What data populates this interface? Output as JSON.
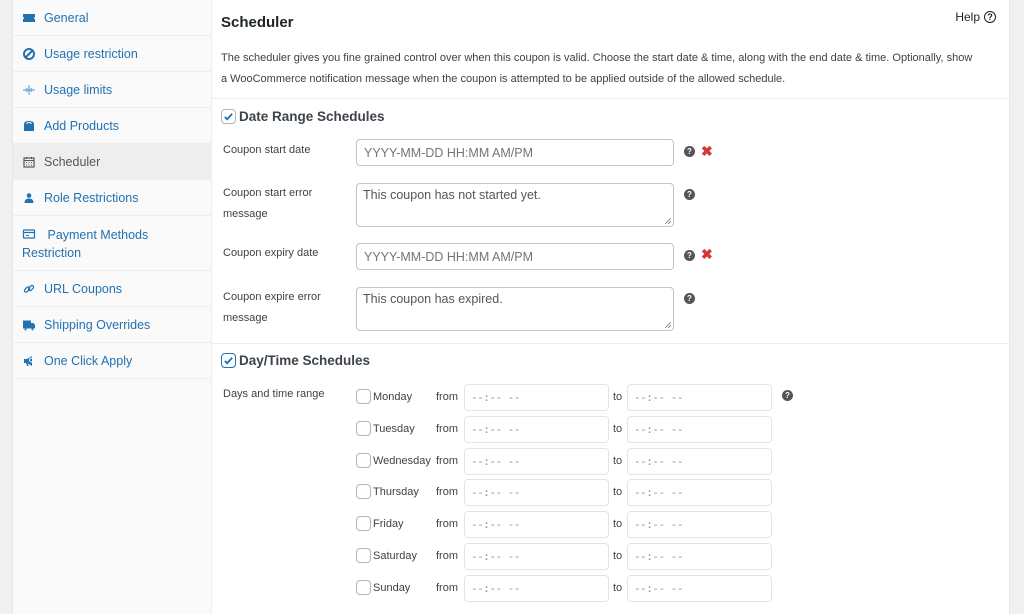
{
  "sidebar": {
    "items": [
      {
        "label": "General",
        "icon": "ticket-icon",
        "active": false
      },
      {
        "label": "Usage restriction",
        "icon": "block-icon",
        "active": false
      },
      {
        "label": "Usage limits",
        "icon": "limits-icon",
        "active": false
      },
      {
        "label": "Add Products",
        "icon": "bag-icon",
        "active": false
      },
      {
        "label": "Scheduler",
        "icon": "calendar-icon",
        "active": true
      },
      {
        "label": "Role Restrictions",
        "icon": "user-icon",
        "active": false
      },
      {
        "label": "Payment Methods Restriction",
        "label_line1": "Payment Methods",
        "label_line2": "Restriction",
        "icon": "card-icon",
        "active": false
      },
      {
        "label": "URL Coupons",
        "icon": "link-icon",
        "active": false
      },
      {
        "label": "Shipping Overrides",
        "icon": "truck-icon",
        "active": false
      },
      {
        "label": "One Click Apply",
        "icon": "megaphone-icon",
        "active": false
      }
    ]
  },
  "panel": {
    "title": "Scheduler",
    "help_label": "Help",
    "help_icon": "?",
    "intro_line1": "The scheduler gives you fine grained control over when this coupon is valid. Choose the start date & time, along with the end date & time. Optionally, show",
    "intro_line2": "a WooCommerce notification message when the coupon is attempted to be applied outside of the allowed schedule."
  },
  "date_range": {
    "heading": "Date Range Schedules",
    "checked": true,
    "start_date": {
      "label": "Coupon start date",
      "value": "",
      "placeholder": "YYYY-MM-DD HH:MM AM/PM"
    },
    "start_error": {
      "label_line1": "Coupon start error",
      "label_line2": "message",
      "value": "This coupon has not started yet."
    },
    "expiry_date": {
      "label": "Coupon expiry date",
      "value": "",
      "placeholder": "YYYY-MM-DD HH:MM AM/PM"
    },
    "expire_error": {
      "label_line1": "Coupon expire error",
      "label_line2": "message",
      "value": "This coupon has expired."
    },
    "tip_icon": "?",
    "remove_icon": "✖"
  },
  "day_time": {
    "heading": "Day/Time Schedules",
    "checked": true,
    "label": "Days and time range",
    "from_label": "from",
    "to_label": "to",
    "time_placeholder": "--:-- --",
    "days": [
      {
        "name": "Monday",
        "checked": false,
        "from": "--:-- --",
        "to": "--:-- --"
      },
      {
        "name": "Tuesday",
        "checked": false,
        "from": "--:-- --",
        "to": "--:-- --"
      },
      {
        "name": "Wednesday",
        "checked": false,
        "from": "--:-- --",
        "to": "--:-- --"
      },
      {
        "name": "Thursday",
        "checked": false,
        "from": "--:-- --",
        "to": "--:-- --"
      },
      {
        "name": "Friday",
        "checked": false,
        "from": "--:-- --",
        "to": "--:-- --"
      },
      {
        "name": "Saturday",
        "checked": false,
        "from": "--:-- --",
        "to": "--:-- --"
      },
      {
        "name": "Sunday",
        "checked": false,
        "from": "--:-- --",
        "to": "--:-- --"
      }
    ]
  },
  "colors": {
    "link": "#2271b1",
    "remove": "#d63638",
    "active_bg": "#eeeeee"
  }
}
